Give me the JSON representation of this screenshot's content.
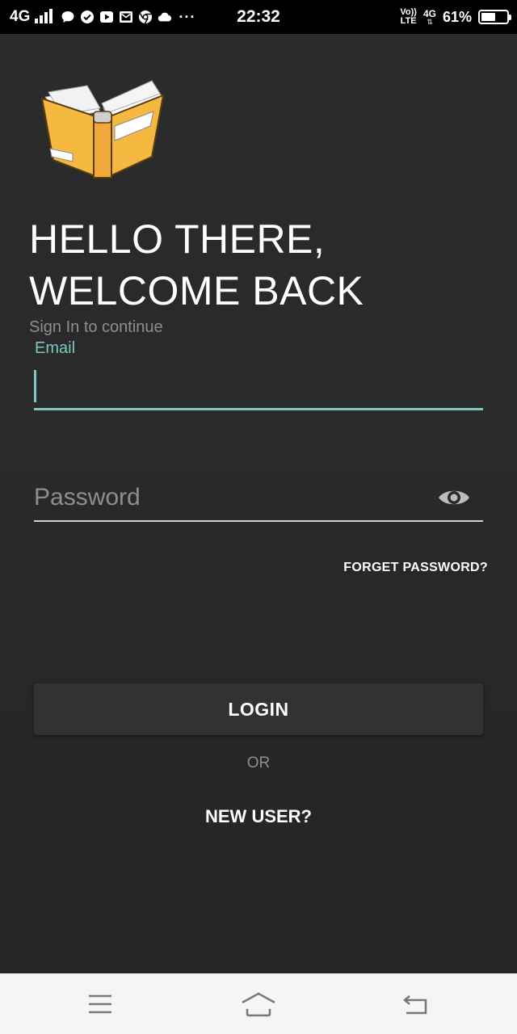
{
  "status_bar": {
    "network": "4G",
    "time": "22:32",
    "volte_top": "Vo))",
    "volte_bottom": "LTE",
    "data_top": "4G",
    "battery_percent": "61%",
    "battery_level": 0.61,
    "notification_icons": [
      "chat-bubble-icon",
      "check-circle-icon",
      "play-icon",
      "mail-icon",
      "chrome-icon",
      "cloud-icon"
    ],
    "more": "···"
  },
  "login": {
    "headline_line1": "HELLO THERE,",
    "headline_line2": "WELCOME BACK",
    "subtitle": "Sign In to continue",
    "email_label": "Email",
    "email_value": "",
    "password_placeholder": "Password",
    "forget_password": "FORGET PASSWORD?",
    "login_button": "LOGIN",
    "or_text": "OR",
    "new_user": "NEW USER?"
  },
  "colors": {
    "accent": "#7cc8c0",
    "background": "#2a2a2a",
    "book": "#f5b942"
  },
  "nav_bar": {
    "icons": [
      "menu-icon",
      "home-icon",
      "back-icon"
    ]
  }
}
